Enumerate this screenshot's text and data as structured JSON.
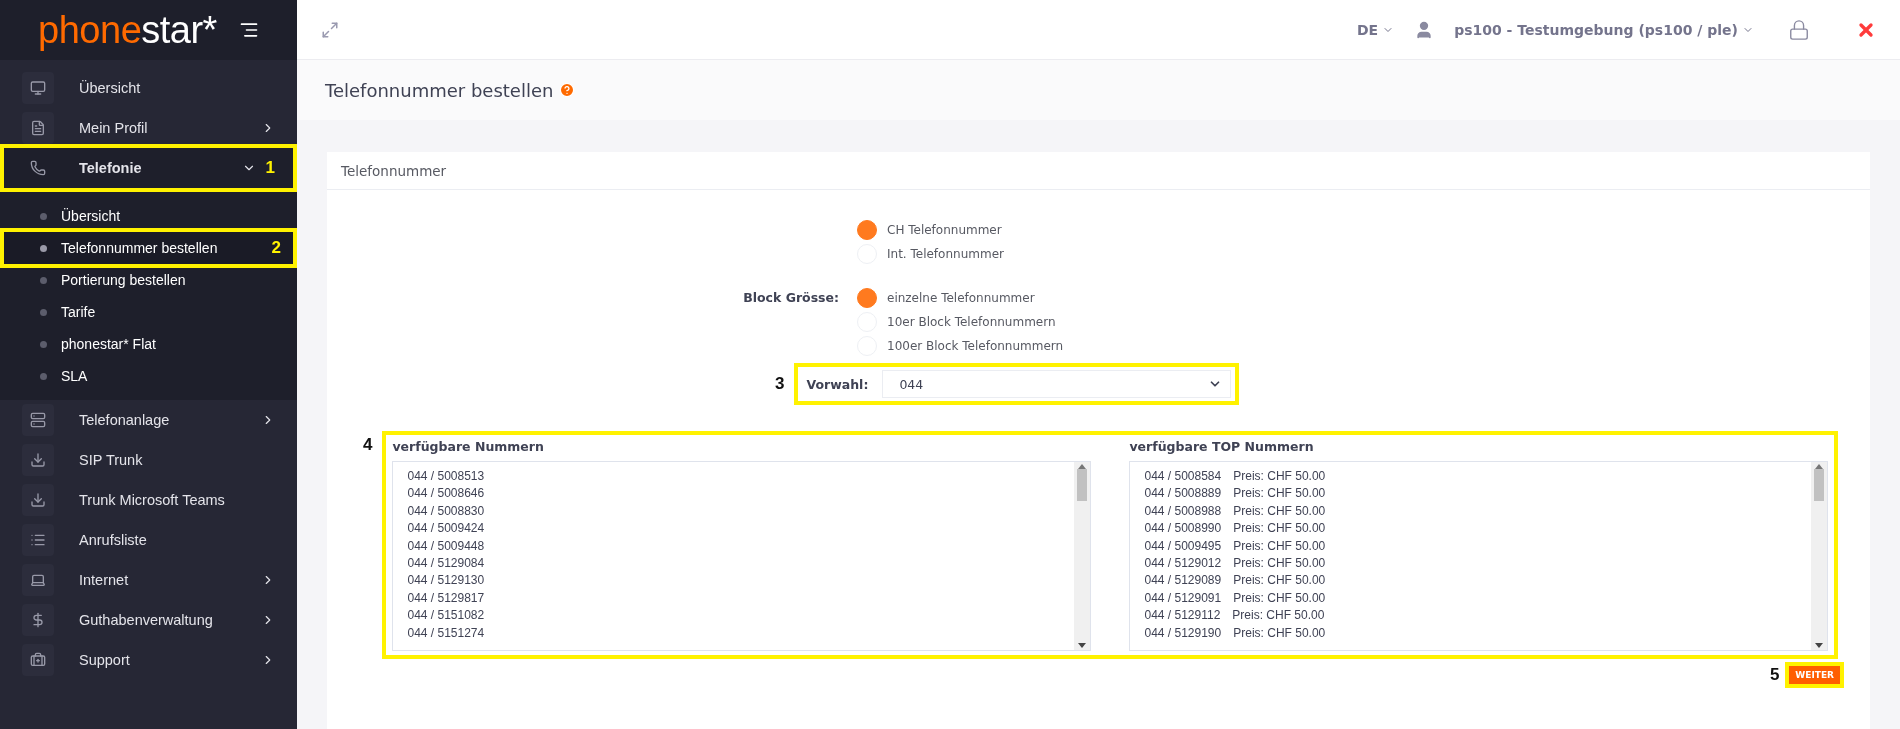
{
  "brand": {
    "accent": "phone",
    "rest": "star*"
  },
  "header": {
    "language": "DE",
    "account": "ps100 - Testumgebung (ps100 / ple)"
  },
  "sidebar": {
    "items": [
      {
        "label": "Übersicht",
        "kind": "link",
        "selected": false
      },
      {
        "label": "Mein Profil",
        "kind": "submenu",
        "expanded": false,
        "selected": false
      },
      {
        "label": "Telefonie",
        "kind": "submenu",
        "expanded": true,
        "selected": true,
        "annotation": "1",
        "children": [
          {
            "label": "Übersicht",
            "selected": false
          },
          {
            "label": "Telefonnummer bestellen",
            "selected": true,
            "annotation": "2"
          },
          {
            "label": "Portierung bestellen",
            "selected": false
          },
          {
            "label": "Tarife",
            "selected": false
          },
          {
            "label": "phonestar* Flat",
            "selected": false
          },
          {
            "label": "SLA",
            "selected": false
          }
        ]
      },
      {
        "label": "Telefonanlage",
        "kind": "submenu",
        "expanded": false,
        "selected": false
      },
      {
        "label": "SIP Trunk",
        "kind": "link",
        "selected": false
      },
      {
        "label": "Trunk Microsoft Teams",
        "kind": "link",
        "selected": false
      },
      {
        "label": "Anrufsliste",
        "kind": "link",
        "selected": false
      },
      {
        "label": "Internet",
        "kind": "submenu",
        "expanded": false,
        "selected": false
      },
      {
        "label": "Guthabenverwaltung",
        "kind": "submenu",
        "expanded": false,
        "selected": false
      },
      {
        "label": "Support",
        "kind": "submenu",
        "expanded": false,
        "selected": false
      }
    ]
  },
  "page": {
    "title": "Telefonnummer bestellen"
  },
  "card": {
    "title": "Telefonnummer",
    "number_type": [
      {
        "label": "CH Telefonnummer",
        "selected": true
      },
      {
        "label": "Int. Telefonnummer",
        "selected": false
      }
    ],
    "block_size": {
      "label": "Block Grösse:",
      "options": [
        {
          "label": "einzelne Telefonnummer",
          "selected": true
        },
        {
          "label": "10er Block Telefonnummern",
          "selected": false
        },
        {
          "label": "100er Block Telefonnummern",
          "selected": false
        }
      ]
    },
    "prefix": {
      "label": "Vorwahl:",
      "value": "044",
      "annotation": "3"
    },
    "lists": {
      "annotation": "4",
      "columns": [
        {
          "title": "verfügbare Nummern",
          "items": [
            {
              "number": "044 / 5008513"
            },
            {
              "number": "044 / 5008646"
            },
            {
              "number": "044 / 5008830"
            },
            {
              "number": "044 / 5009424"
            },
            {
              "number": "044 / 5009448"
            },
            {
              "number": "044 / 5129084"
            },
            {
              "number": "044 / 5129130"
            },
            {
              "number": "044 / 5129817"
            },
            {
              "number": "044 / 5151082"
            },
            {
              "number": "044 / 5151274"
            }
          ]
        },
        {
          "title": "verfügbare TOP Nummern",
          "items": [
            {
              "number": "044 / 5008584",
              "price": "Preis: CHF 50.00"
            },
            {
              "number": "044 / 5008889",
              "price": "Preis: CHF 50.00"
            },
            {
              "number": "044 / 5008988",
              "price": "Preis: CHF 50.00"
            },
            {
              "number": "044 / 5008990",
              "price": "Preis: CHF 50.00"
            },
            {
              "number": "044 / 5009495",
              "price": "Preis: CHF 50.00"
            },
            {
              "number": "044 / 5129012",
              "price": "Preis: CHF 50.00"
            },
            {
              "number": "044 / 5129089",
              "price": "Preis: CHF 50.00"
            },
            {
              "number": "044 / 5129091",
              "price": "Preis: CHF 50.00"
            },
            {
              "number": "044 / 5129112",
              "price": "Preis: CHF 50.00"
            },
            {
              "number": "044 / 5129190",
              "price": "Preis: CHF 50.00"
            }
          ]
        }
      ]
    },
    "next_button": {
      "label": "WEITER",
      "annotation": "5"
    }
  }
}
